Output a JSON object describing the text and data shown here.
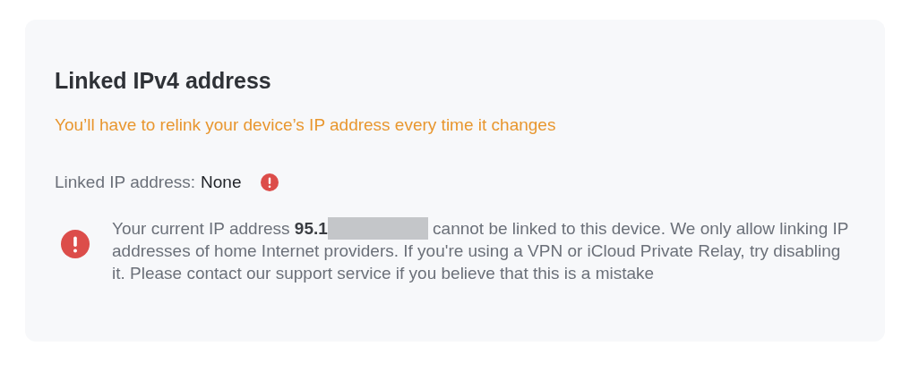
{
  "card": {
    "title": "Linked IPv4 address",
    "warning": "You’ll have to relink your device’s IP address every time it changes",
    "linked_ip": {
      "label": "Linked IP address:",
      "value": "None",
      "error": true
    },
    "alert": {
      "message_start": "Your current IP address **95.1**",
      "redacted": true,
      "message_end": " cannot be linked to this device. We only allow linking IP addresses of home Internet providers. If you're using a VPN or iCloud Private Relay, try disabling it. Please contact our support service if you believe that this is a mistake"
    }
  }
}
